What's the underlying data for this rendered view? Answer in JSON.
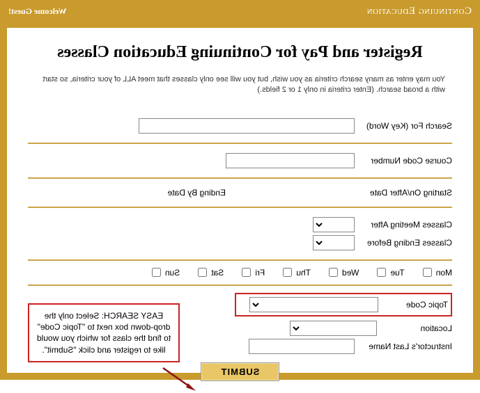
{
  "header": {
    "title": "Continuing Education",
    "welcome": "Welcome Guest!"
  },
  "page_title": "Register and Pay for Continuing Education Classes",
  "intro": "You may enter as many search criteria as you wish, but you will see only classes that meet ALL of your criteria, so start with a broad search. (Enter criteria in only 1 or 2 fields.)",
  "fields": {
    "keyword_label": "Search For (Key Word)",
    "course_code_label": "Course Code Number",
    "start_date_label": "Starting On/After Date",
    "end_date_label": "Ending By Date",
    "meeting_after_label": "Classes Meeting After",
    "ending_before_label": "Classes Ending Before",
    "topic_label": "Topic Code",
    "location_label": "Location",
    "instructor_label": "Instructor's Last Name"
  },
  "days": [
    {
      "label": "Mon"
    },
    {
      "label": "Tue"
    },
    {
      "label": "Wed"
    },
    {
      "label": "Thu"
    },
    {
      "label": "Fri"
    },
    {
      "label": "Sat"
    },
    {
      "label": "Sun"
    }
  ],
  "callout_text": "EASY SEARCH: Select only the drop-down box next to \"Topic Code\" to find the class for which you would like to register and click \"Submit\".",
  "submit_label": "SUBMIT",
  "colors": {
    "brand": "#c99a2c",
    "highlight": "#c22"
  }
}
